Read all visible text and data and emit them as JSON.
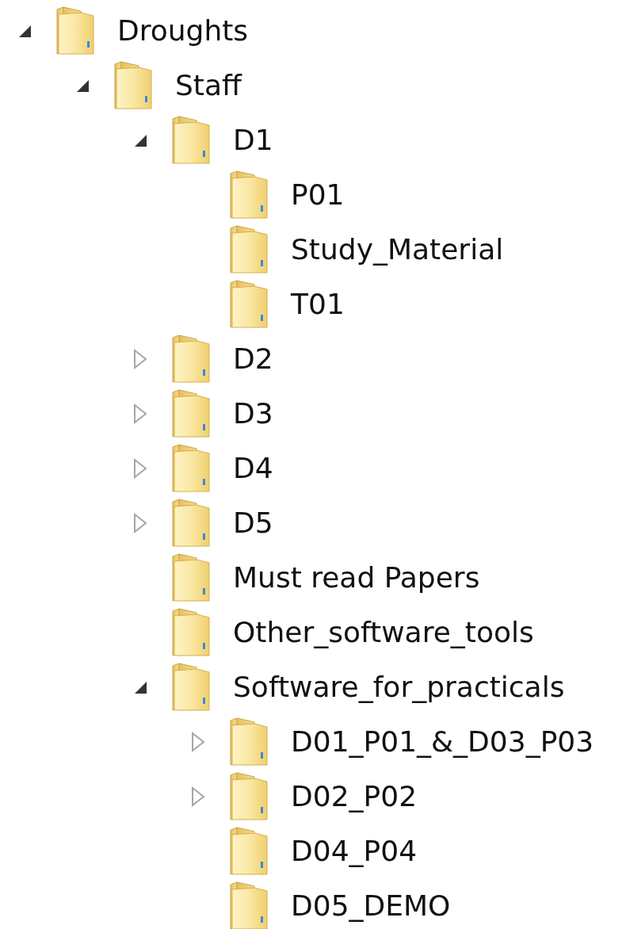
{
  "tree": [
    {
      "label": "Droughts",
      "expanded": true,
      "children": [
        {
          "label": "Staff",
          "expanded": true,
          "children": [
            {
              "label": "D1",
              "expanded": true,
              "children": [
                {
                  "label": "P01"
                },
                {
                  "label": "Study_Material"
                },
                {
                  "label": "T01"
                }
              ]
            },
            {
              "label": "D2",
              "expanded": false
            },
            {
              "label": "D3",
              "expanded": false
            },
            {
              "label": "D4",
              "expanded": false
            },
            {
              "label": "D5",
              "expanded": false
            },
            {
              "label": "Must read Papers"
            },
            {
              "label": "Other_software_tools"
            },
            {
              "label": "Software_for_practicals",
              "expanded": true,
              "children": [
                {
                  "label": "D01_P01_&_D03_P03",
                  "expanded": false
                },
                {
                  "label": "D02_P02",
                  "expanded": false
                },
                {
                  "label": "D04_P04"
                },
                {
                  "label": "D05_DEMO"
                }
              ]
            }
          ]
        }
      ]
    }
  ]
}
